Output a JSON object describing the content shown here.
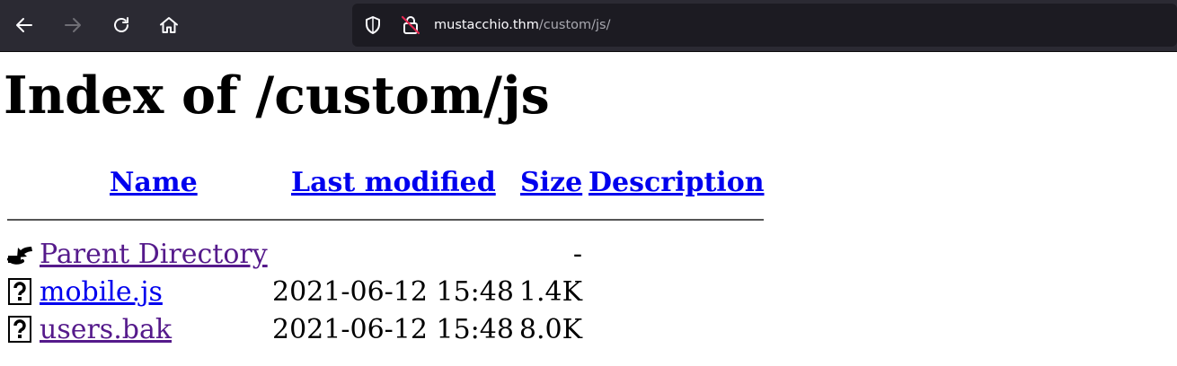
{
  "browser": {
    "url_host": "mustacchio.thm",
    "url_path": "/custom/js/",
    "icons": [
      "back-arrow-icon",
      "forward-arrow-icon",
      "reload-icon",
      "home-icon",
      "shield-icon",
      "insecure-lock-icon"
    ]
  },
  "page": {
    "heading": "Index of /custom/js",
    "columns": {
      "name": "Name",
      "last_modified": "Last modified",
      "size": "Size",
      "description": "Description"
    },
    "rows": [
      {
        "icon": "back-folder-icon",
        "name": "Parent Directory",
        "modified": "",
        "size": "-",
        "description": "",
        "visited": true
      },
      {
        "icon": "unknown-file-icon",
        "name": "mobile.js",
        "modified": "2021-06-12 15:48",
        "size": "1.4K",
        "description": "",
        "visited": false
      },
      {
        "icon": "unknown-file-icon",
        "name": "users.bak",
        "modified": "2021-06-12 15:48",
        "size": "8.0K",
        "description": "",
        "visited": true
      }
    ]
  },
  "colors": {
    "link": "#0000ee",
    "visited_link": "#551a8b",
    "toolbar_bg": "#2b2a33",
    "urlbar_bg": "#1c1b22"
  }
}
